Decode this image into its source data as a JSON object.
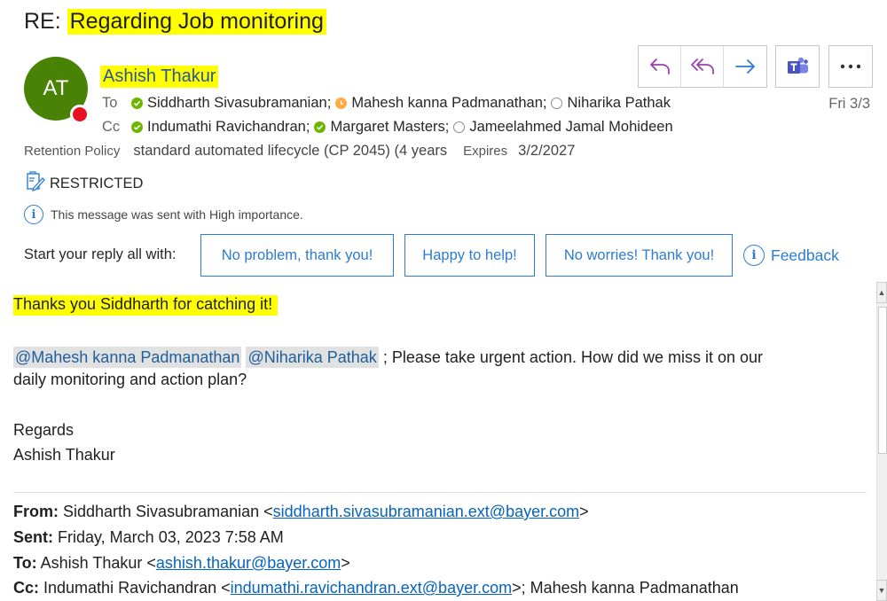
{
  "subject": {
    "prefix": "RE: ",
    "text": "Regarding Job monitoring"
  },
  "sender": {
    "initials": "AT",
    "name": "Ashish Thakur",
    "presence": "busy"
  },
  "date": "Fri 3/3",
  "to": {
    "label": "To",
    "recipients": [
      {
        "name": "Siddharth Sivasubramanian",
        "status": "available",
        "sep": ";"
      },
      {
        "name": "Mahesh kanna Padmanathan",
        "status": "away",
        "sep": ";"
      },
      {
        "name": "Niharika Pathak",
        "status": "offline",
        "sep": ""
      }
    ]
  },
  "cc": {
    "label": "Cc",
    "recipients": [
      {
        "name": "Indumathi Ravichandran",
        "status": "available",
        "sep": ";"
      },
      {
        "name": "Margaret Masters",
        "status": "available",
        "sep": ";"
      },
      {
        "name": "Jameelahmed Jamal Mohideen",
        "status": "offline",
        "sep": ""
      }
    ]
  },
  "retention": {
    "label": "Retention Policy",
    "value": "standard automated lifecycle (CP 2045) (4 years",
    "expires_label": "Expires",
    "expires_value": "3/2/2027"
  },
  "classification": "RESTRICTED",
  "importance_note": "This message was sent with High importance.",
  "quick_reply": {
    "label": "Start your reply all with:",
    "options": [
      "No problem, thank you!",
      "Happy to help!",
      "No worries! Thank you!"
    ],
    "feedback": "Feedback"
  },
  "toolbar": {
    "reply": "reply-icon",
    "reply_all": "reply-all-icon",
    "forward": "forward-icon",
    "teams": "teams-icon",
    "more": "more-icon"
  },
  "body": {
    "thanks": "Thanks you Siddharth for catching it!",
    "mention1": "@Mahesh kanna Padmanathan",
    "mention2": "@Niharika Pathak",
    "line1_rest": " ; Please take urgent action. How did we miss it on our",
    "line2": "daily monitoring and action plan?",
    "regards": "Regards",
    "signature": "Ashish Thakur"
  },
  "quoted": {
    "from_label": "From:",
    "from_name": " Siddharth Sivasubramanian <",
    "from_email": "siddharth.sivasubramanian.ext@bayer.com",
    "from_close": ">",
    "sent_label": "Sent:",
    "sent_value": " Friday, March 03, 2023 7:58 AM",
    "to_label": "To:",
    "to_name": " Ashish Thakur <",
    "to_email": "ashish.thakur@bayer.com",
    "to_close": ">",
    "cc_label": "Cc:",
    "cc_name": " Indumathi Ravichandran <",
    "cc_email": "indumathi.ravichandran.ext@bayer.com",
    "cc_rest": ">; Mahesh kanna Padmanathan"
  },
  "colors": {
    "highlight": "#ffff00",
    "avatar": "#498205",
    "accent": "#2b7cd3",
    "reply_purple": "#9b3fb5",
    "presence_busy": "#e81123"
  }
}
